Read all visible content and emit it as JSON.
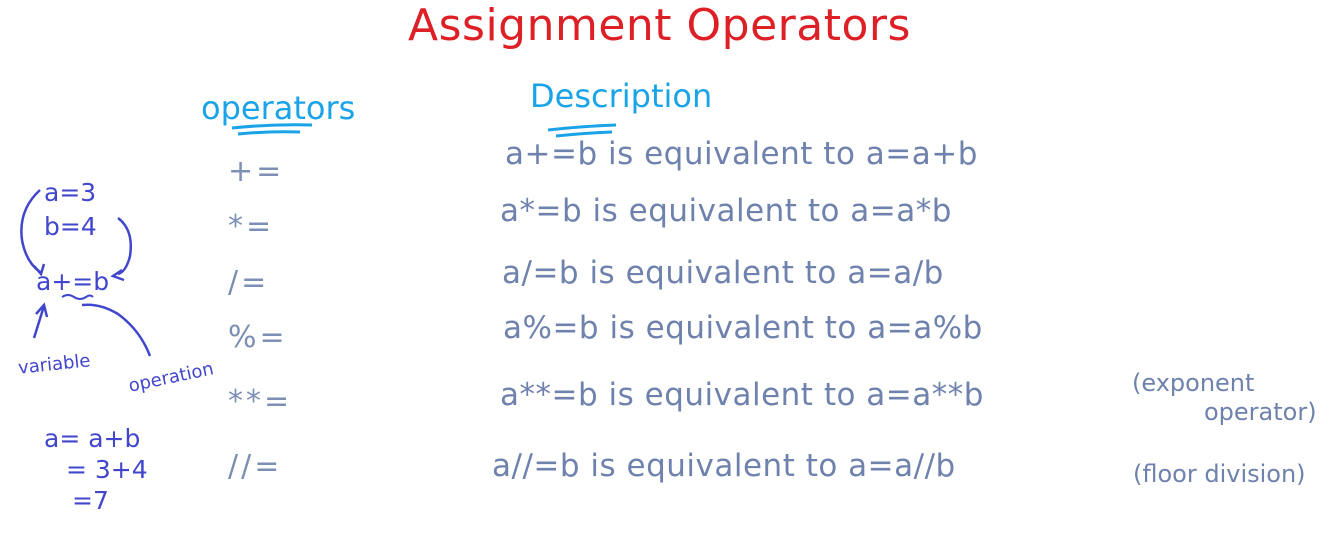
{
  "title": "Assignment Operators",
  "headers": {
    "operators": "operators",
    "description": "Description"
  },
  "rows": [
    {
      "op": "+=",
      "desc": "a+=b is equivalent to a=a+b",
      "note": ""
    },
    {
      "op": "*=",
      "desc": "a*=b is equivalent to a=a*b",
      "note": ""
    },
    {
      "op": "/=",
      "desc": "a/=b is equivalent to a=a/b",
      "note": ""
    },
    {
      "op": "%=",
      "desc": "a%=b is equivalent to a=a%b",
      "note": ""
    },
    {
      "op": "**=",
      "desc": "a**=b is equivalent to a=a**b",
      "note_line1": "(exponent",
      "note_line2": "operator)"
    },
    {
      "op": "//=",
      "desc": "a//=b is equivalent to a=a//b",
      "note": "(floor division)"
    }
  ],
  "example": {
    "a_line": "a=3",
    "b_line": "b=4",
    "expr": "a+=b",
    "label_variable": "variable",
    "label_operation": "operation",
    "calc_1": "a= a+b",
    "calc_2": "= 3+4",
    "calc_3": "=7"
  },
  "colors": {
    "title": "#dd1f26",
    "header": "#1ba3e8",
    "body_text": "#6f82ad",
    "side_notes": "#4146cc"
  }
}
